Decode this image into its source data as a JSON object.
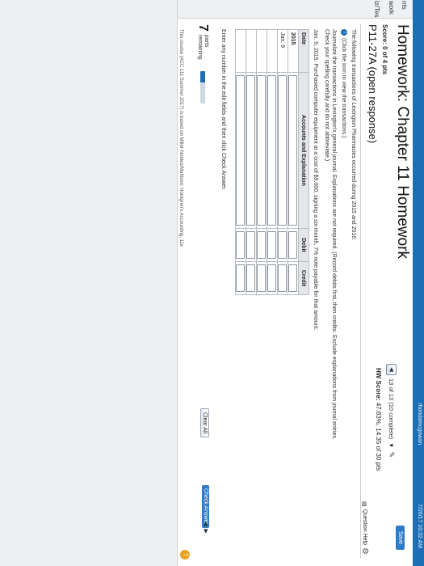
{
  "browser": {
    "top_info": "rhondamcgowan",
    "clock": "7/26/17 10:32 AM"
  },
  "left_strip": [
    "nts",
    "work",
    "iz/Tes"
  ],
  "header": {
    "title": "Homework: Chapter 11 Homework",
    "score": "Score: 0 of 4 pts",
    "nav_position": "13 of 13 (10 complete)",
    "hw_score_label": "HW Score:",
    "hw_score_value": "47.83%, 14.35 of 30 pts",
    "save_label": "Save"
  },
  "problem": {
    "id": "P11-27A (open response)",
    "question_help": "Question Help"
  },
  "instructions": {
    "intro": "The following transactions of Lexington Pharmacies occurred during 2015 and 2016:",
    "icon_hint": "(Click the icon to view the transactions.)",
    "journalize": "Journalize the transactions in Lexington's general journal. Explanations are not required. (Record debits first, then credits. Exclude explanations from journal entries.",
    "spelling": "Check your spelling carefully and do not abbreviate.)",
    "transaction": "Jan. 9, 2015: Purchased computer equipment at a cost of $9,000, signing a six-month, 7% note payable for that amount."
  },
  "journal": {
    "headers": {
      "date": "Date",
      "accounts": "Accounts and Explanation",
      "debit": "Debit",
      "credit": "Credit"
    },
    "year": "2015",
    "date": "Jan. 9"
  },
  "footer_area": {
    "enter_hint": "Enter any number in the edit fields and then click Check Answer.",
    "parts_count": "7",
    "parts_label_1": "parts",
    "parts_label_2": "remaining",
    "clear_all": "Clear All",
    "check_answer": "Check Answer",
    "course_note": "This course (ACC 111 Summer 2017) is based on Miller-Nobles/Mattison: Horngren's Accounting, 11e"
  },
  "progress_fraction": 0.35,
  "colors": {
    "accent": "#1c6fb5",
    "button": "#2d7cc8",
    "help": "#e8a322"
  }
}
